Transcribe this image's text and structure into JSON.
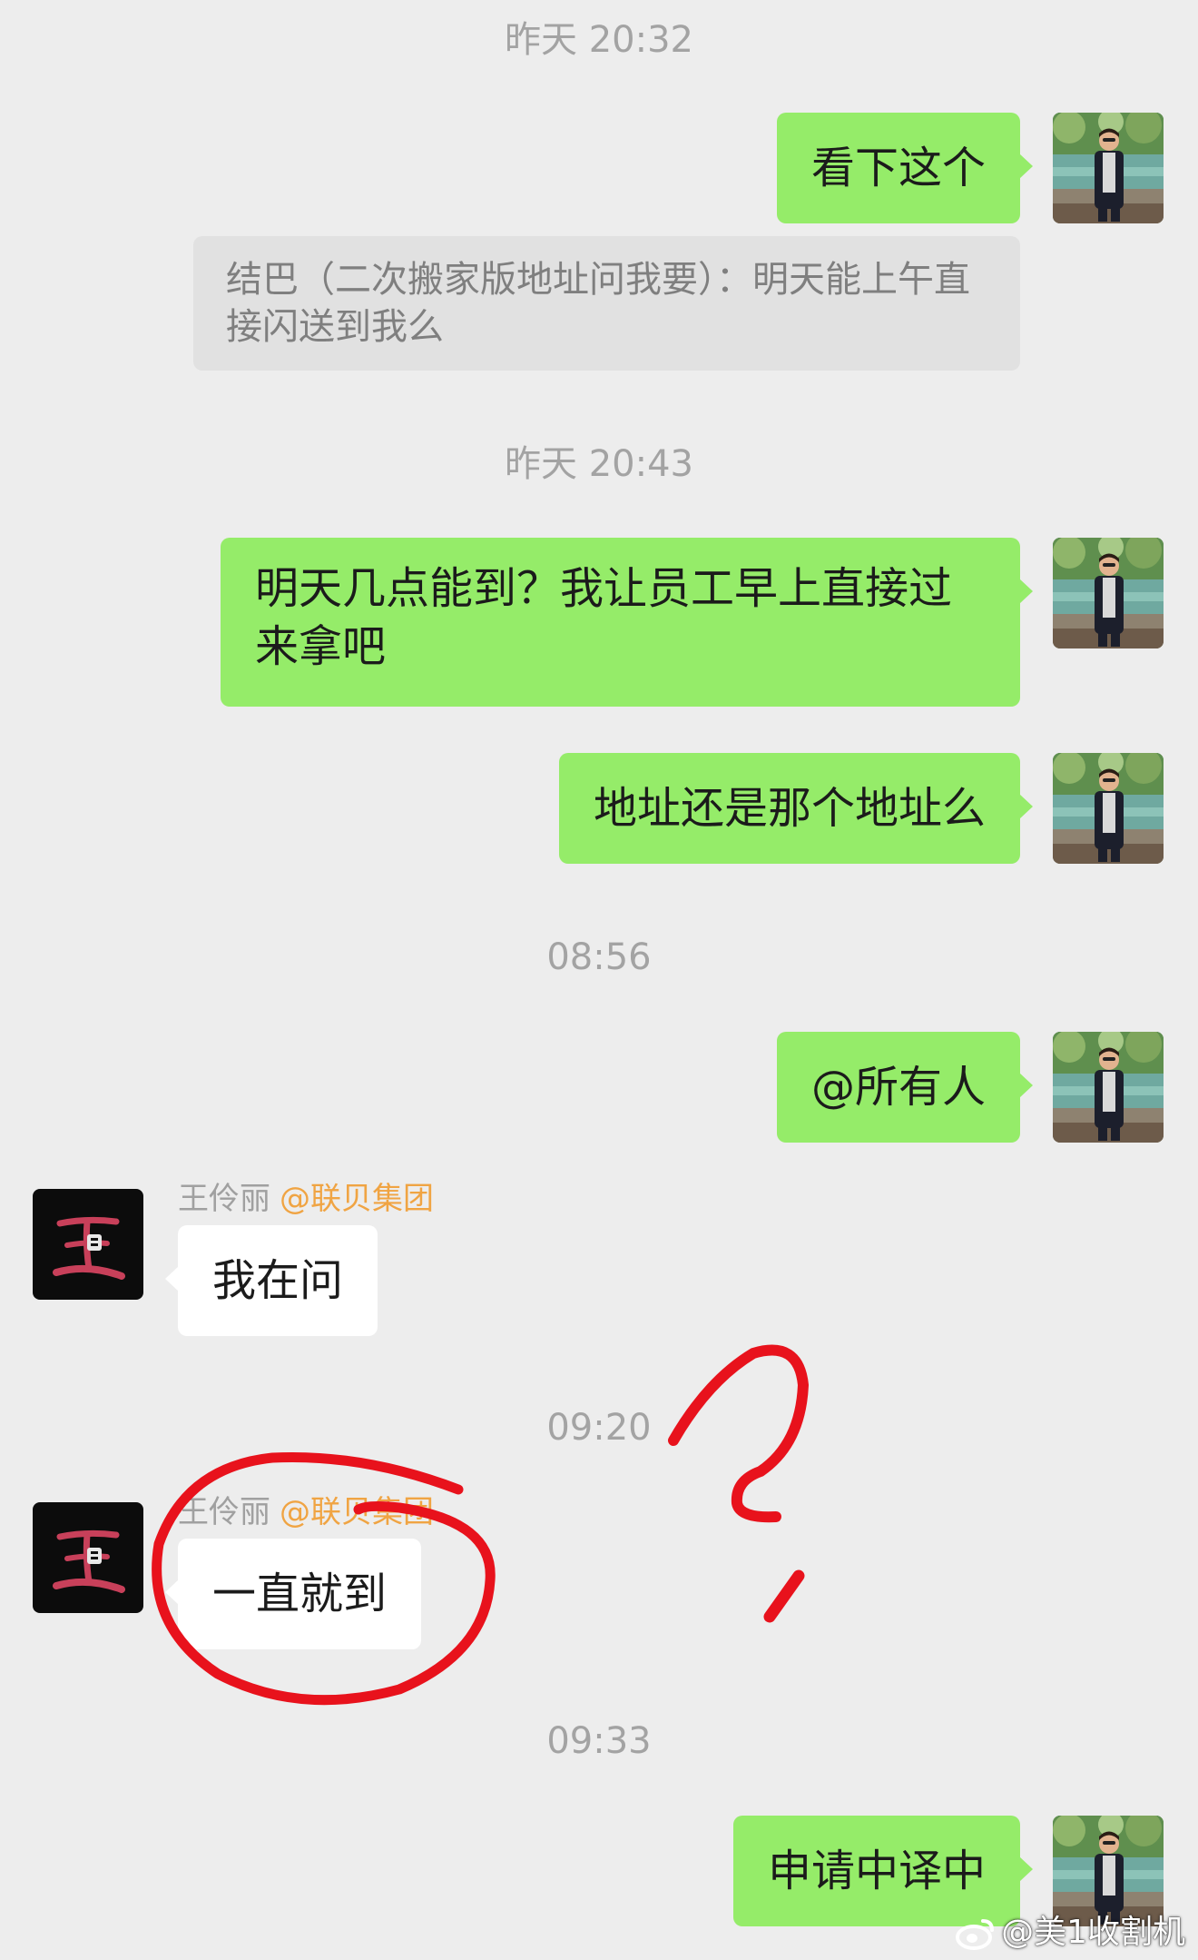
{
  "messages": {
    "ts1": "昨天 20:32",
    "m1": "看下这个",
    "quote1": "结巴（二次搬家版地址问我要）：明天能上午直接闪送到我么",
    "ts2": "昨天 20:43",
    "m2": "明天几点能到？我让员工早上直接过来拿吧",
    "m3": "地址还是那个地址么",
    "ts3": "08:56",
    "m4": "@所有人",
    "sender1_name": "王伶丽",
    "sender1_group": "@联贝集团",
    "m5": "我在问",
    "ts4": "09:20",
    "sender2_name": "王伶丽",
    "sender2_group": "@联贝集团",
    "m6": "一直就到",
    "ts5": "09:33",
    "m7": "申请中译中"
  },
  "avatar_other": {
    "glyph": "玉"
  },
  "watermark": {
    "text": "@美1收割机"
  },
  "colors": {
    "background": "#ededed",
    "my_bubble": "#95ec69",
    "other_bubble": "#ffffff",
    "group_tag": "#f0a443",
    "annotation": "#e8121c"
  },
  "icons": [
    "my-avatar-photo",
    "other-avatar-calligraphy",
    "weibo-icon"
  ]
}
